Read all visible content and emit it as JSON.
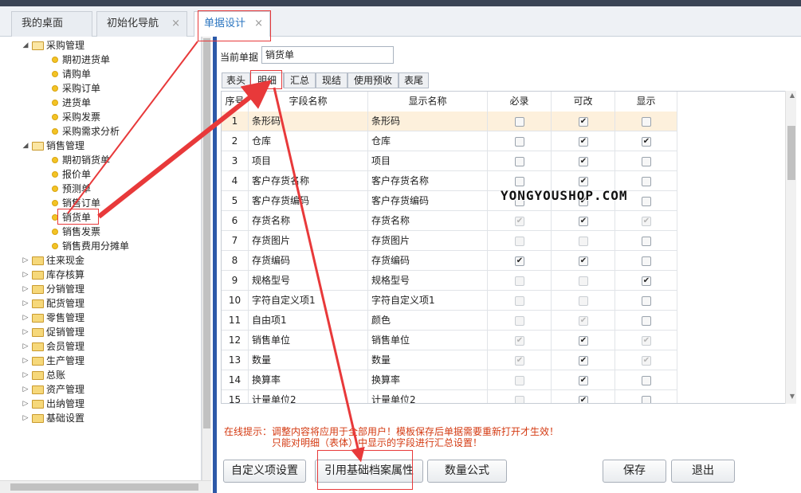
{
  "tabs": [
    {
      "label": "我的桌面"
    },
    {
      "label": "初始化导航",
      "close": "×"
    },
    {
      "label": "单据设计",
      "close": "×"
    }
  ],
  "tree": [
    {
      "label": "采购管理",
      "expanded": true,
      "children": [
        "期初进货单",
        "请购单",
        "采购订单",
        "进货单",
        "采购发票",
        "采购需求分析"
      ]
    },
    {
      "label": "销售管理",
      "expanded": true,
      "children": [
        "期初销货单",
        "报价单",
        "预测单",
        "销售订单",
        "销货单",
        "销售发票",
        "销售费用分摊单"
      ]
    },
    {
      "label": "往来现金"
    },
    {
      "label": "库存核算"
    },
    {
      "label": "分销管理"
    },
    {
      "label": "配货管理"
    },
    {
      "label": "零售管理"
    },
    {
      "label": "促销管理"
    },
    {
      "label": "会员管理"
    },
    {
      "label": "生产管理"
    },
    {
      "label": "总账"
    },
    {
      "label": "资产管理"
    },
    {
      "label": "出纳管理"
    },
    {
      "label": "基础设置"
    }
  ],
  "current_doc": {
    "label": "当前单据",
    "value": "销货单"
  },
  "subtabs": [
    "表头",
    "明细",
    "汇总",
    "现结",
    "使用预收",
    "表尾"
  ],
  "grid": {
    "headers": [
      "序号",
      "字段名称",
      "显示名称",
      "必录",
      "可改",
      "显示"
    ],
    "rows": [
      {
        "no": "1",
        "field": "条形码",
        "display": "条形码",
        "req": [
          false,
          true
        ],
        "edit": [
          true,
          true
        ],
        "show": [
          false,
          true
        ]
      },
      {
        "no": "2",
        "field": "仓库",
        "display": "仓库",
        "req": [
          false,
          true
        ],
        "edit": [
          true,
          true
        ],
        "show": [
          true,
          true
        ]
      },
      {
        "no": "3",
        "field": "项目",
        "display": "项目",
        "req": [
          false,
          true
        ],
        "edit": [
          true,
          true
        ],
        "show": [
          false,
          true
        ]
      },
      {
        "no": "4",
        "field": "客户存货名称",
        "display": "客户存货名称",
        "req": [
          false,
          true
        ],
        "edit": [
          true,
          true
        ],
        "show": [
          false,
          true
        ]
      },
      {
        "no": "5",
        "field": "客户存货编码",
        "display": "客户存货编码",
        "req": [
          false,
          true
        ],
        "edit": [
          true,
          true
        ],
        "show": [
          false,
          true
        ]
      },
      {
        "no": "6",
        "field": "存货名称",
        "display": "存货名称",
        "req": [
          true,
          false
        ],
        "edit": [
          true,
          true
        ],
        "show": [
          true,
          false
        ]
      },
      {
        "no": "7",
        "field": "存货图片",
        "display": "存货图片",
        "req": [
          false,
          false
        ],
        "edit": [
          false,
          false
        ],
        "show": [
          false,
          true
        ]
      },
      {
        "no": "8",
        "field": "存货编码",
        "display": "存货编码",
        "req": [
          true,
          true
        ],
        "edit": [
          true,
          true
        ],
        "show": [
          false,
          true
        ]
      },
      {
        "no": "9",
        "field": "规格型号",
        "display": "规格型号",
        "req": [
          false,
          false
        ],
        "edit": [
          false,
          false
        ],
        "show": [
          true,
          true
        ]
      },
      {
        "no": "10",
        "field": "字符自定义项1",
        "display": "字符自定义项1",
        "req": [
          false,
          false
        ],
        "edit": [
          false,
          false
        ],
        "show": [
          false,
          true
        ]
      },
      {
        "no": "11",
        "field": "自由项1",
        "display": "颜色",
        "req": [
          false,
          false
        ],
        "edit": [
          true,
          false
        ],
        "show": [
          false,
          true
        ]
      },
      {
        "no": "12",
        "field": "销售单位",
        "display": "销售单位",
        "req": [
          true,
          false
        ],
        "edit": [
          true,
          true
        ],
        "show": [
          true,
          false
        ]
      },
      {
        "no": "13",
        "field": "数量",
        "display": "数量",
        "req": [
          true,
          false
        ],
        "edit": [
          true,
          true
        ],
        "show": [
          true,
          false
        ]
      },
      {
        "no": "14",
        "field": "换算率",
        "display": "换算率",
        "req": [
          false,
          false
        ],
        "edit": [
          true,
          true
        ],
        "show": [
          false,
          true
        ]
      },
      {
        "no": "15",
        "field": "计量单位2",
        "display": "计量单位2",
        "req": [
          false,
          false
        ],
        "edit": [
          true,
          true
        ],
        "show": [
          false,
          true
        ]
      }
    ]
  },
  "hint": {
    "line1": "在线提示：调整内容将应用于全部用户！模板保存后单据需要重新打开才生效！",
    "line2": "只能对明细（表体）中显示的字段进行汇总设置！"
  },
  "buttons": {
    "custom": "自定义项设置",
    "ref": "引用基础档案属性",
    "formula": "数量公式",
    "save": "保存",
    "exit": "退出"
  },
  "watermark": "YONGYOUSHOP.COM",
  "colors": {
    "annotation": "#e8393a",
    "active_tab": "#2b75c0",
    "hint": "#d43a12",
    "splitter": "#2d59a8"
  }
}
